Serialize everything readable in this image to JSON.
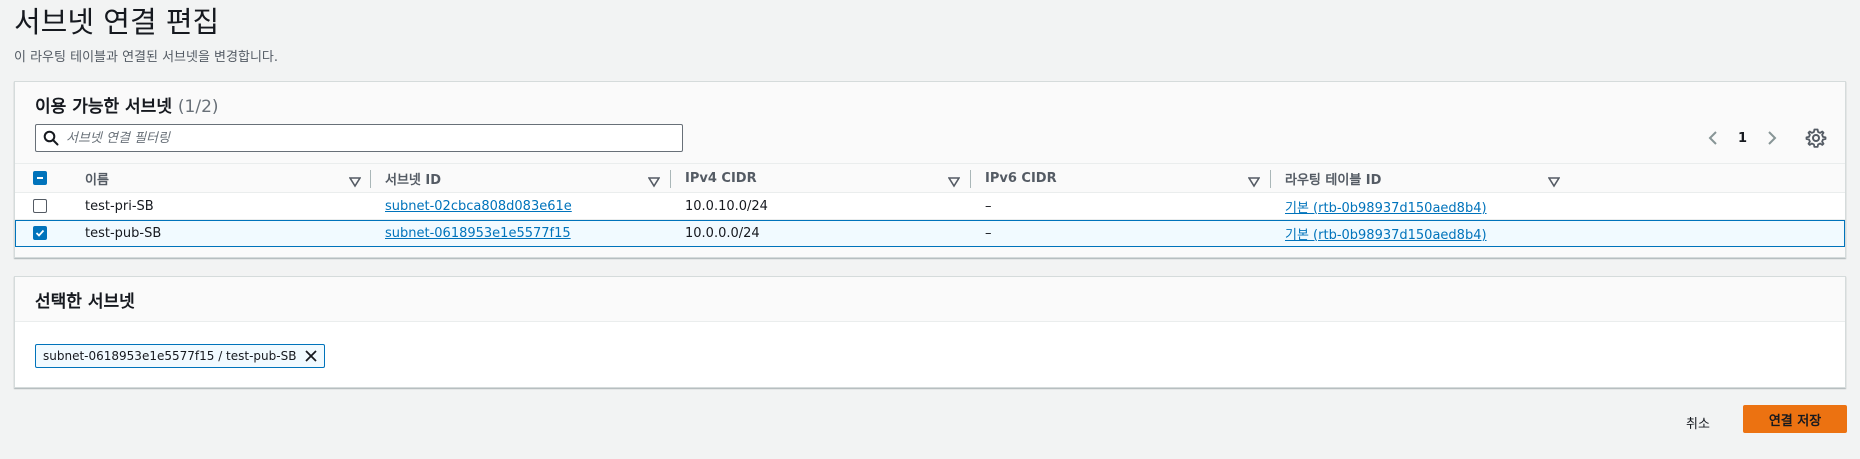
{
  "page": {
    "title": "서브넷 연결 편집",
    "description": "이 라우팅 테이블과 연결된 서브넷을 변경합니다."
  },
  "available": {
    "title": "이용 가능한 서브넷",
    "count": "(1/2)",
    "filter_placeholder": "서브넷 연결 필터링",
    "page_number": "1",
    "columns": [
      "이름",
      "서브넷 ID",
      "IPv4 CIDR",
      "IPv6 CIDR",
      "라우팅 테이블 ID"
    ],
    "rows": [
      {
        "checked": false,
        "name": "test-pri-SB",
        "subnet_id": "subnet-02cbca808d083e61e",
        "ipv4": "10.0.10.0/24",
        "ipv6": "–",
        "route_table": "기본 (rtb-0b98937d150aed8b4)"
      },
      {
        "checked": true,
        "name": "test-pub-SB",
        "subnet_id": "subnet-0618953e1e5577f15",
        "ipv4": "10.0.0.0/24",
        "ipv6": "–",
        "route_table": "기본 (rtb-0b98937d150aed8b4)"
      }
    ]
  },
  "selected": {
    "title": "선택한 서브넷",
    "token": "subnet-0618953e1e5577f15 / test-pub-SB"
  },
  "actions": {
    "cancel": "취소",
    "save": "연결 저장"
  },
  "colors": {
    "accent": "#0073bb",
    "primary_button": "#ec7211",
    "background": "#f2f3f3"
  }
}
